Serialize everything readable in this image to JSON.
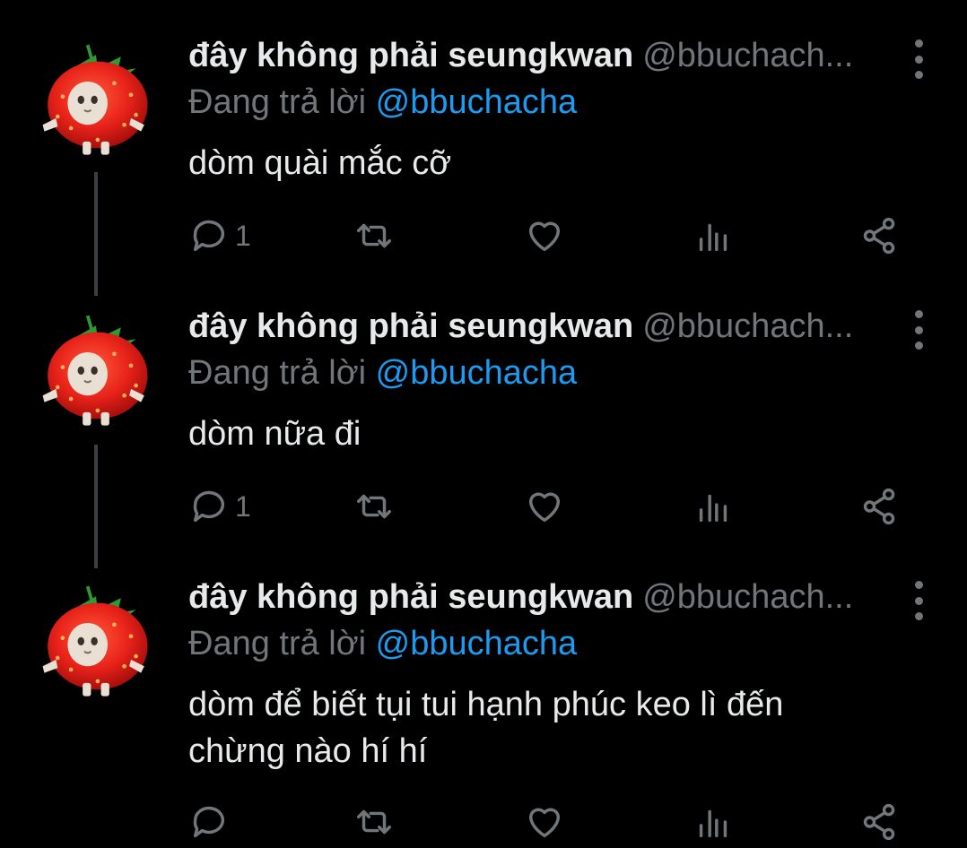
{
  "tweets": [
    {
      "name": "đây không phải seungkwan",
      "handle": "@bbuchach...",
      "replying_prefix": "Đang trả lời",
      "replying_to": "@bbuchacha",
      "text": "dòm quài mắc cỡ",
      "reply_count": "1"
    },
    {
      "name": "đây không phải seungkwan",
      "handle": "@bbuchach...",
      "replying_prefix": "Đang trả lời",
      "replying_to": "@bbuchacha",
      "text": "dòm nữa đi",
      "reply_count": "1"
    },
    {
      "name": "đây không phải seungkwan",
      "handle": "@bbuchach...",
      "replying_prefix": "Đang trả lời",
      "replying_to": "@bbuchacha",
      "text": "dòm để biết tụi tui hạnh phúc keo lì đến chừng nào hí hí",
      "reply_count": ""
    }
  ],
  "colors": {
    "background": "#000000",
    "text": "#e7e9ea",
    "muted": "#71767b",
    "link": "#1d9bf0",
    "thread_line": "#3d4043"
  },
  "icons": [
    "strawberry-cat-avatar",
    "more-options-icon",
    "reply-icon",
    "retweet-icon",
    "like-icon",
    "views-icon",
    "share-icon"
  ]
}
